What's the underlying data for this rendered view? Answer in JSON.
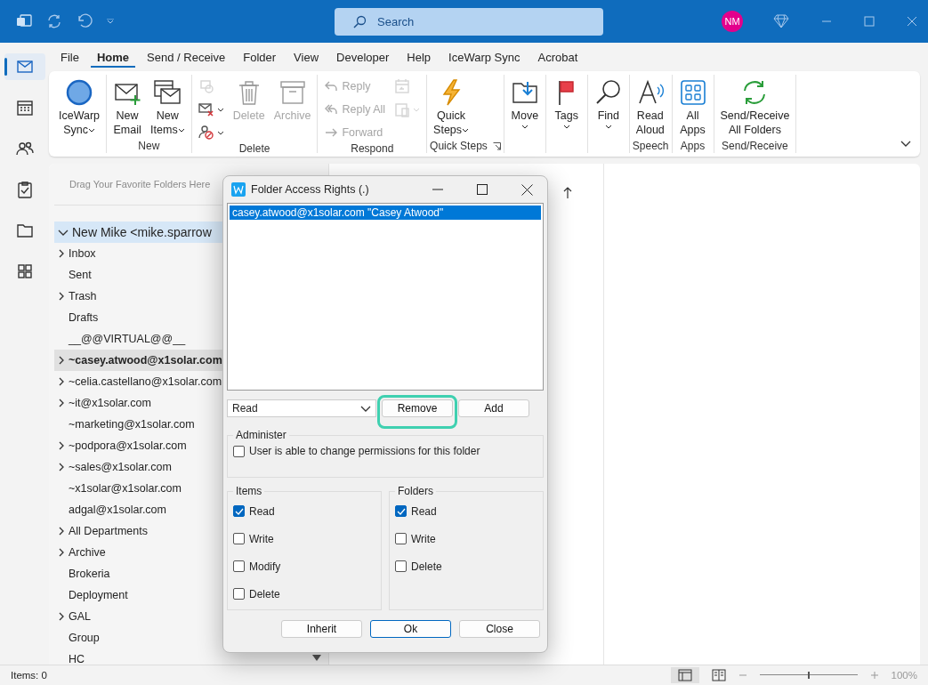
{
  "title_bar": {
    "search": {
      "placeholder": "Search"
    },
    "avatar": "NM"
  },
  "nav_rail": [
    {
      "selected": true
    },
    {
      "selected": false
    },
    {
      "selected": false
    },
    {
      "selected": false
    },
    {
      "selected": false
    },
    {
      "selected": false
    }
  ],
  "menu_tabs": [
    {
      "label": "File",
      "selected": false
    },
    {
      "label": "Home",
      "selected": true
    },
    {
      "label": "Send / Receive",
      "selected": false
    },
    {
      "label": "Folder",
      "selected": false
    },
    {
      "label": "View",
      "selected": false
    },
    {
      "label": "Developer",
      "selected": false
    },
    {
      "label": "Help",
      "selected": false
    },
    {
      "label": "IceWarp Sync",
      "selected": false
    },
    {
      "label": "Acrobat",
      "selected": false
    }
  ],
  "ribbon": {
    "groups": [
      {
        "columns": [
          [
            {
              "kind": "large",
              "label": "IceWarp\nSync",
              "caret": true,
              "disabled": false
            }
          ]
        ]
      },
      {
        "label": "New",
        "columns": [
          [
            {
              "kind": "large",
              "label": "New\nEmail",
              "caret": false,
              "disabled": false
            }
          ],
          [
            {
              "kind": "large",
              "label": "New\nItems",
              "caret": true,
              "disabled": false
            }
          ]
        ]
      },
      {
        "label": "Delete",
        "columns": [
          [
            {
              "kind": "icon",
              "caret": false,
              "disabled": true
            },
            {
              "kind": "icon",
              "caret": true,
              "disabled": false
            },
            {
              "kind": "icon",
              "caret": true,
              "disabled": false
            }
          ],
          [
            {
              "kind": "large",
              "label": "Delete",
              "caret": false,
              "disabled": true
            }
          ],
          [
            {
              "kind": "large",
              "label": "Archive",
              "caret": false,
              "disabled": true
            }
          ]
        ]
      },
      {
        "label": "Respond",
        "columns": [
          [
            {
              "kind": "small",
              "label": "Reply",
              "caret": false,
              "disabled": true
            },
            {
              "kind": "small",
              "label": "Reply All",
              "caret": false,
              "disabled": true
            },
            {
              "kind": "small",
              "label": "Forward",
              "caret": false,
              "disabled": true
            }
          ],
          [
            {
              "kind": "icon",
              "caret": false,
              "disabled": true
            },
            {
              "kind": "icon",
              "caret": true,
              "disabled": true
            }
          ]
        ]
      },
      {
        "label": "Quick Steps",
        "launcher": true,
        "columns": [
          [
            {
              "kind": "large",
              "label": "Quick\nSteps",
              "caret": true,
              "disabled": false
            }
          ]
        ]
      },
      {
        "columns": [
          [
            {
              "kind": "menu",
              "label": "Move",
              "caret": true,
              "disabled": false
            }
          ]
        ]
      },
      {
        "columns": [
          [
            {
              "kind": "menu",
              "label": "Tags",
              "caret": true,
              "disabled": false
            }
          ]
        ]
      },
      {
        "columns": [
          [
            {
              "kind": "menu",
              "label": "Find",
              "caret": true,
              "disabled": false
            }
          ]
        ]
      },
      {
        "label": "Speech",
        "columns": [
          [
            {
              "kind": "large",
              "label": "Read\nAloud",
              "caret": false,
              "disabled": false
            }
          ]
        ]
      },
      {
        "label": "Apps",
        "columns": [
          [
            {
              "kind": "large",
              "label": "All\nApps",
              "caret": false,
              "disabled": false
            }
          ]
        ]
      },
      {
        "label": "Send/Receive",
        "columns": [
          [
            {
              "kind": "large",
              "label": "Send/Receive\nAll Folders",
              "caret": false,
              "disabled": false
            }
          ]
        ]
      }
    ]
  },
  "folder_pane": {
    "favorites_hint": "Drag Your Favorite Folders Here",
    "account": {
      "label": "New Mike <mike.sparrow",
      "expanded": true,
      "children": [
        {
          "label": "Inbox",
          "expanded": false,
          "selected": false
        },
        {
          "label": "Sent",
          "selected": false
        },
        {
          "label": "Trash",
          "expanded": false,
          "selected": false
        },
        {
          "label": "Drafts",
          "selected": false
        },
        {
          "label": "__@@VIRTUAL@@__",
          "selected": false
        },
        {
          "label": "~casey.atwood@x1solar.com",
          "expanded": false,
          "selected": true
        },
        {
          "label": "~celia.castellano@x1solar.com",
          "expanded": false,
          "selected": false
        },
        {
          "label": "~it@x1solar.com",
          "expanded": false,
          "selected": false
        },
        {
          "label": "~marketing@x1solar.com",
          "selected": false
        },
        {
          "label": "~podpora@x1solar.com",
          "expanded": false,
          "selected": false
        },
        {
          "label": "~sales@x1solar.com",
          "expanded": false,
          "selected": false
        },
        {
          "label": "~x1solar@x1solar.com",
          "selected": false
        },
        {
          "label": "adgal@x1solar.com",
          "selected": false
        },
        {
          "label": "All Departments",
          "expanded": false,
          "selected": false
        },
        {
          "label": "Archive",
          "expanded": false,
          "selected": false
        },
        {
          "label": "Brokeria",
          "selected": false
        },
        {
          "label": "Deployment",
          "selected": false
        },
        {
          "label": "GAL",
          "expanded": false,
          "selected": false
        },
        {
          "label": "Group",
          "selected": false
        },
        {
          "label": "HC",
          "selected": false
        }
      ]
    }
  },
  "status_bar": {
    "items": "Items: 0",
    "zoom": {
      "level": 0.5,
      "reading": "100%"
    }
  },
  "dialog": {
    "title": "Folder Access Rights (.)",
    "users": [
      {
        "label": "casey.atwood@x1solar.com \"Casey Atwood\"",
        "selected": true
      }
    ],
    "rights_select": {
      "value": "Read"
    },
    "list_buttons": [
      {
        "label": "Remove",
        "highlighted": true
      },
      {
        "label": "Add",
        "highlighted": false
      }
    ],
    "administer": {
      "legend": "Administer",
      "options": [
        {
          "label": "User is able to change permissions for this folder",
          "checked": false
        }
      ]
    },
    "items": {
      "legend": "Items",
      "options": [
        {
          "label": "Read",
          "checked": true
        },
        {
          "label": "Write",
          "checked": false
        },
        {
          "label": "Modify",
          "checked": false
        },
        {
          "label": "Delete",
          "checked": false
        }
      ]
    },
    "folders": {
      "legend": "Folders",
      "options": [
        {
          "label": "Read",
          "checked": true
        },
        {
          "label": "Write",
          "checked": false
        },
        {
          "label": "Delete",
          "checked": false
        }
      ]
    },
    "footer_buttons": [
      {
        "label": "Inherit",
        "default": false
      },
      {
        "label": "Ok",
        "default": true
      },
      {
        "label": "Close",
        "default": false
      }
    ]
  }
}
